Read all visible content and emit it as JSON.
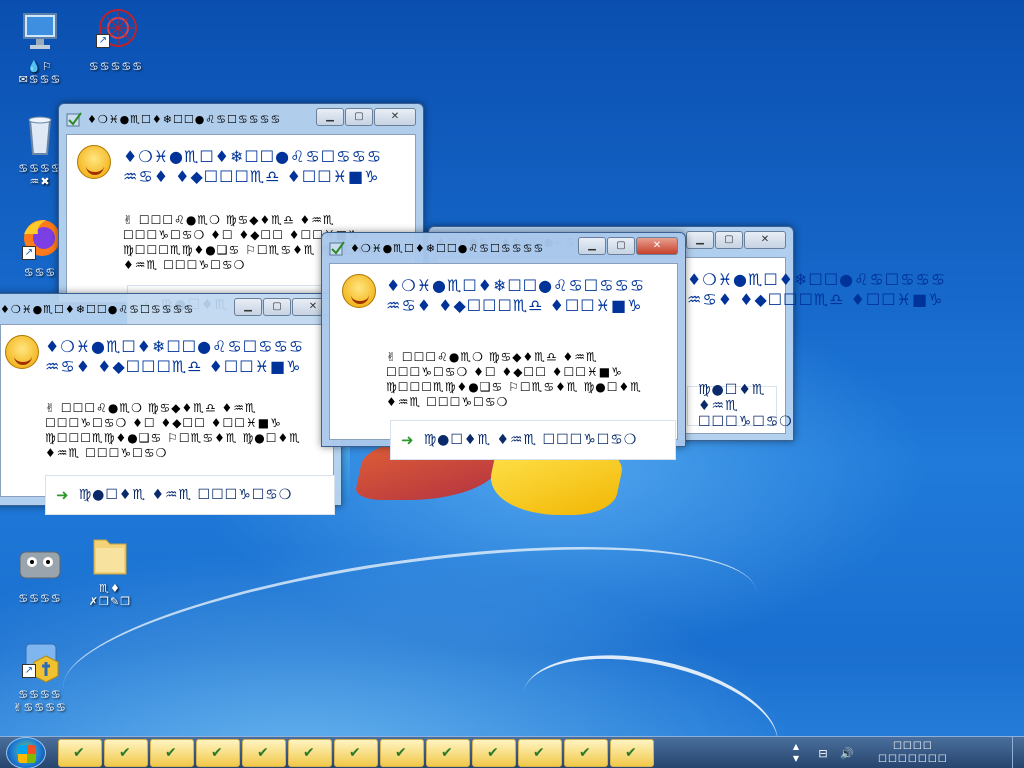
{
  "desktop": {
    "icons": [
      {
        "id": "computer",
        "label": "💧⚐\n✉♋♋♋",
        "icon": "computer-icon"
      },
      {
        "id": "app",
        "label": "♋♋♋♋♋",
        "icon": "app-icon"
      },
      {
        "id": "recycle",
        "label": "♋♋♋♋\n♒✖",
        "icon": "recycle-bin-icon"
      },
      {
        "id": "firefox",
        "label": "♋♋♋",
        "icon": "firefox-icon"
      },
      {
        "id": "robot",
        "label": "♋♋♋♋",
        "icon": "robot-icon"
      },
      {
        "id": "folder",
        "label": "♏♦\n✗❒✎❒",
        "icon": "folder-icon"
      },
      {
        "id": "control",
        "label": "♋♋♋♋\n✌♋♋♋♋",
        "icon": "control-panel-icon"
      }
    ]
  },
  "dialog": {
    "title": "♦❍♓●♏☐♦❄☐☐●♌♋☐♋♋♋♋",
    "heading_line1": "♦❍♓●♏☐♦❄☐☐●♌♋☐♋♋♋",
    "heading_line2": "♒♋♦ ♦◆☐☐☐♏♎ ♦☐☐♓■♑",
    "body_line1": "✌ ☐☐☐♌●♏❍ ♍♋◆♦♏♎ ♦♒♏",
    "body_line2": "☐☐☐♑☐♋❍ ♦☐ ♦◆☐☐ ♦☐☐♓■♑",
    "body_line3": "♍☐☐☐♏♍♦●❑♋ ⚐☐♏♋♦♏ ♍●☐♦♏",
    "body_line4": "♦♒♏ ☐☐☐♑☐♋❍",
    "command_label": "♍●☐♦♏ ♦♒♏ ☐☐☐♑☐♋❍",
    "minimize": "▁",
    "maximize": "▢",
    "close": "✕"
  },
  "taskbar": {
    "button_count": 13,
    "clock_line1": "☐☐☐☐",
    "clock_line2": "☐☐☐☐☐☐☐",
    "tray_icons": [
      "network-icon",
      "volume-icon",
      "flag-icon"
    ]
  },
  "colors": {
    "heading": "#003399",
    "accent_green": "#2e9a2e",
    "close_red": "#c7402c"
  }
}
